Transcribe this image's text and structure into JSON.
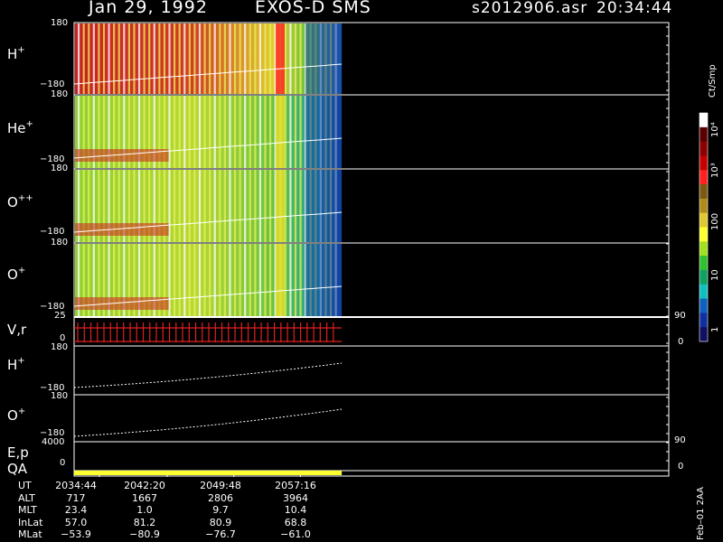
{
  "header": {
    "date": "Jan 29, 1992",
    "instrument": "EXOS-D SMS",
    "filename": "s2012906.asr",
    "time": "20:34:44"
  },
  "panels": [
    {
      "label_main": "H",
      "label_sup": "+",
      "ytop": "180",
      "ybot": "−180"
    },
    {
      "label_main": "He",
      "label_sup": "+",
      "ytop": "180",
      "ybot": "−180"
    },
    {
      "label_main": "O",
      "label_sup": "++",
      "ytop": "180",
      "ybot": "−180"
    },
    {
      "label_main": "O",
      "label_sup": "+",
      "ytop": "180",
      "ybot": "−180"
    },
    {
      "label_main": "V,r",
      "label_sup": "",
      "ytop": "25",
      "ybot": "0",
      "rtop": "90",
      "rbot": "0"
    },
    {
      "label_main": "H",
      "label_sup": "+",
      "ytop": "180",
      "ybot": "−180"
    },
    {
      "label_main": "O",
      "label_sup": "+",
      "ytop": "180",
      "ybot": "−180"
    },
    {
      "label_main": "E,p",
      "label_sup": "",
      "ytop": "4000",
      "ybot": "0",
      "rtop": "90",
      "rbot": "0"
    },
    {
      "label_main": "QA",
      "label_sup": "",
      "ytop": "",
      "ybot": ""
    }
  ],
  "colorbar": {
    "unit": "Ct/Smp",
    "labels": [
      "10⁴",
      "10³",
      "100",
      "10",
      "1"
    ],
    "colors": [
      "#ffffff",
      "#5a0000",
      "#8b0000",
      "#c40000",
      "#ff2020",
      "#7a5a10",
      "#b08a1a",
      "#e0c830",
      "#ffff30",
      "#a0e020",
      "#30c030",
      "#10a060",
      "#10c0c0",
      "#1060c0",
      "#1030a0",
      "#101060"
    ]
  },
  "table": {
    "row_labels": [
      "UT",
      "ALT",
      "MLT",
      "InLat",
      "MLat"
    ],
    "columns": [
      [
        "2034:44",
        "717",
        "23.4",
        "57.0",
        "−53.9"
      ],
      [
        "2042:20",
        "1667",
        "1.0",
        "81.2",
        "−80.9"
      ],
      [
        "2049:48",
        "2806",
        "9.7",
        "80.9",
        "−76.7"
      ],
      [
        "2057:16",
        "3964",
        "10.4",
        "68.8",
        "−61.0"
      ]
    ]
  },
  "version_label": "Feb–01 2AA",
  "chart_data": {
    "type": "heatmap",
    "title": "Jan 29, 1992   EXOS-D SMS",
    "x_ticks": [
      "2034:44",
      "2042:20",
      "2049:48",
      "2057:16"
    ],
    "data_coverage_fraction": 0.45,
    "panels": [
      "H+",
      "He+",
      "O++",
      "O+",
      "V,r",
      "H+",
      "O+",
      "E,p",
      "QA"
    ],
    "spectrogram_ylim": [
      -180,
      180
    ],
    "velocity_ylim": [
      0,
      25
    ],
    "energy_ylim": [
      0,
      4000
    ],
    "colorbar_scale": "log",
    "colorbar_range": [
      1,
      10000
    ]
  }
}
